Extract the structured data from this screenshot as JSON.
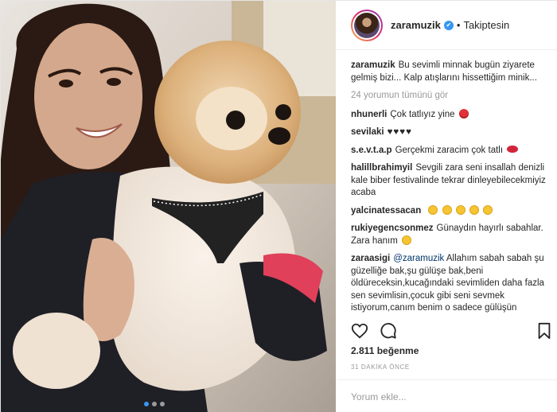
{
  "header": {
    "username": "zaramuzik",
    "verified_mark": "✔",
    "separator": "•",
    "follow_status": "Takiptesin"
  },
  "caption": {
    "user": "zaramuzik",
    "text": "Bu sevimli minnak bugün ziyarete gelmiş bizi... Kalp atışlarını hissettiğim minik..."
  },
  "view_all": "24 yorumun tümünü gör",
  "comments": [
    {
      "user": "nhunerli",
      "text": "Çok tatlıyız yine",
      "emoji": "rose"
    },
    {
      "user": "sevilaki",
      "text": "♥♥♥♥"
    },
    {
      "user": "s.e.v.t.a.p",
      "text": "Gerçekmi zaracim çok tatlı",
      "emoji": "lips"
    },
    {
      "user": "halillbrahimyil",
      "text": "Sevgili zara seni insallah denizli kale biber festivalinde tekrar dinleyebilecekmiyiz acaba"
    },
    {
      "user": "yalcinatessacan",
      "text": "",
      "emoji": "smile",
      "emoji_count": 5
    },
    {
      "user": "rukiyegencsonmez",
      "text": "Günaydın hayırlı sabahlar. Zara hanım",
      "emoji": "blush"
    },
    {
      "user": "zaraasigi",
      "mention": "@zaramuzik",
      "text": "Allahım sabah sabah şu güzelliğe bak,şu gülüşe bak,beni öldüreceksin,kucağındaki sevimliden daha fazla sen sevimlisin,çocuk gibi seni sevmek istiyorum,canım benim o sadece gülüşün"
    }
  ],
  "icons": {
    "like": "heart-outline-icon",
    "comment": "speech-bubble-icon",
    "save": "bookmark-icon"
  },
  "likes": "2.811 beğenme",
  "timestamp": "31 DAKİKA ÖNCE",
  "add_comment": {
    "placeholder": "Yorum ekle..."
  },
  "colors": {
    "link": "#003569",
    "verified": "#3897f0",
    "muted": "#999999"
  }
}
